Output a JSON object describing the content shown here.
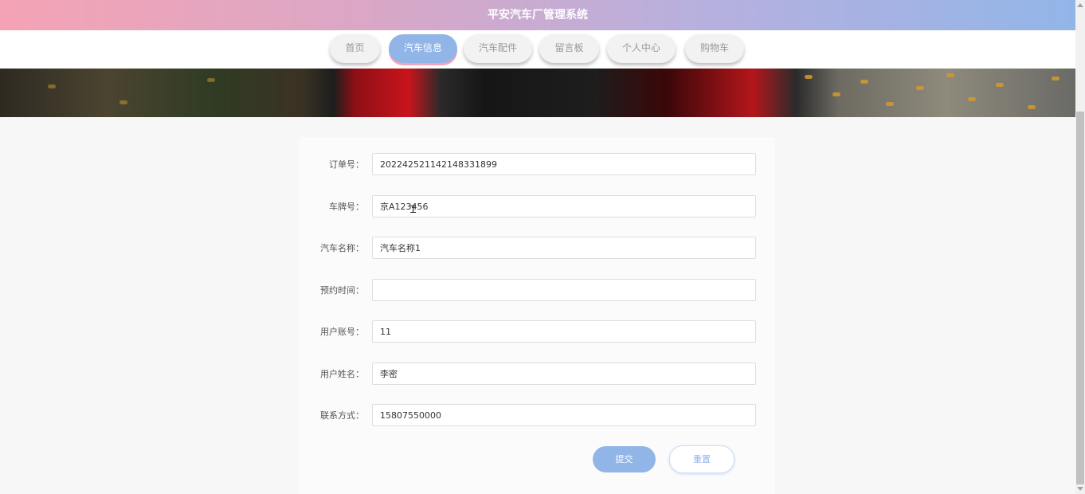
{
  "header": {
    "title": "平安汽车厂管理系统"
  },
  "nav": {
    "items": [
      {
        "label": "首页"
      },
      {
        "label": "汽车信息",
        "active": true
      },
      {
        "label": "汽车配件"
      },
      {
        "label": "留言板"
      },
      {
        "label": "个人中心"
      },
      {
        "label": "购物车"
      }
    ]
  },
  "form": {
    "fields": [
      {
        "label": "订单号：",
        "value": "202242521142148331899"
      },
      {
        "label": "车牌号：",
        "value": "京A123456"
      },
      {
        "label": "汽车名称：",
        "value": "汽车名称1"
      },
      {
        "label": "预约时间：",
        "value": ""
      },
      {
        "label": "用户账号：",
        "value": "11"
      },
      {
        "label": "用户姓名：",
        "value": "李密"
      },
      {
        "label": "联系方式：",
        "value": "15807550000"
      }
    ],
    "submit_label": "提交",
    "reset_label": "重置"
  },
  "colors": {
    "accent": "#92b5e8",
    "pink": "#f5a3b4"
  }
}
